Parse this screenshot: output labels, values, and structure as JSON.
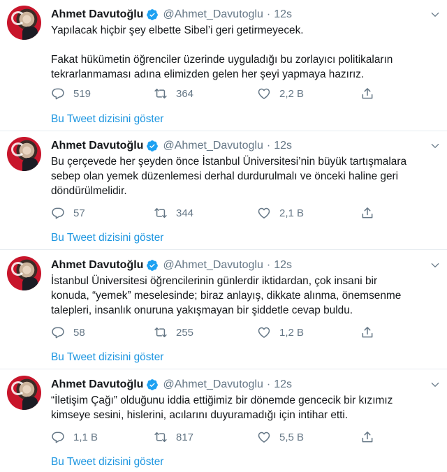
{
  "tweets": [
    {
      "name": "Ahmet Davutoğlu",
      "handle": "@Ahmet_Davutoglu",
      "time": "12s",
      "lines": [
        "Yapılacak hiçbir şey elbette  Sibel’i geri getirmeyecek.",
        "",
        "Fakat hükümetin öğrenciler üzerinde uyguladığı bu zorlayıcı politikaların",
        "tekrarlanmaması adına elimizden gelen her şeyi yapmaya hazırız."
      ],
      "replies": "519",
      "retweets": "364",
      "likes": "2,2 B",
      "show_thread": "Bu Tweet dizisini göster"
    },
    {
      "name": "Ahmet Davutoğlu",
      "handle": "@Ahmet_Davutoglu",
      "time": "12s",
      "lines": [
        "Bu çerçevede her şeyden önce İstanbul Üniversitesi’nin büyük tartışmalara",
        "sebep olan yemek düzenlemesi derhal durdurulmalı ve önceki haline geri",
        "döndürülmelidir."
      ],
      "replies": "57",
      "retweets": "344",
      "likes": "2,1 B",
      "show_thread": "Bu Tweet dizisini göster"
    },
    {
      "name": "Ahmet Davutoğlu",
      "handle": "@Ahmet_Davutoglu",
      "time": "12s",
      "lines": [
        "İstanbul Üniversitesi öğrencilerinin günlerdir iktidardan, çok insani bir",
        "konuda, “yemek” meselesinde; biraz anlayış, dikkate alınma, önemsenme",
        "talepleri, insanlık onuruna yakışmayan bir şiddetle cevap buldu."
      ],
      "replies": "58",
      "retweets": "255",
      "likes": "1,2 B",
      "show_thread": "Bu Tweet dizisini göster"
    },
    {
      "name": "Ahmet Davutoğlu",
      "handle": "@Ahmet_Davutoglu",
      "time": "12s",
      "lines": [
        "“İletişim Çağı” olduğunu iddia ettiğimiz bir dönemde gencecik bir kızımız",
        "kimseye sesini, hislerini, acılarını duyuramadığı için intihar etti."
      ],
      "replies": "1,1 B",
      "retweets": "817",
      "likes": "5,5 B",
      "show_thread": "Bu Tweet dizisini göster"
    }
  ],
  "icons": {
    "reply": "reply-icon",
    "retweet": "retweet-icon",
    "like": "like-icon",
    "share": "share-icon",
    "verified": "verified-badge-icon",
    "caret": "chevron-down-icon"
  },
  "colors": {
    "link": "#1b95e0",
    "verified": "#1da1f2",
    "muted": "#657786",
    "text": "#14171a"
  }
}
